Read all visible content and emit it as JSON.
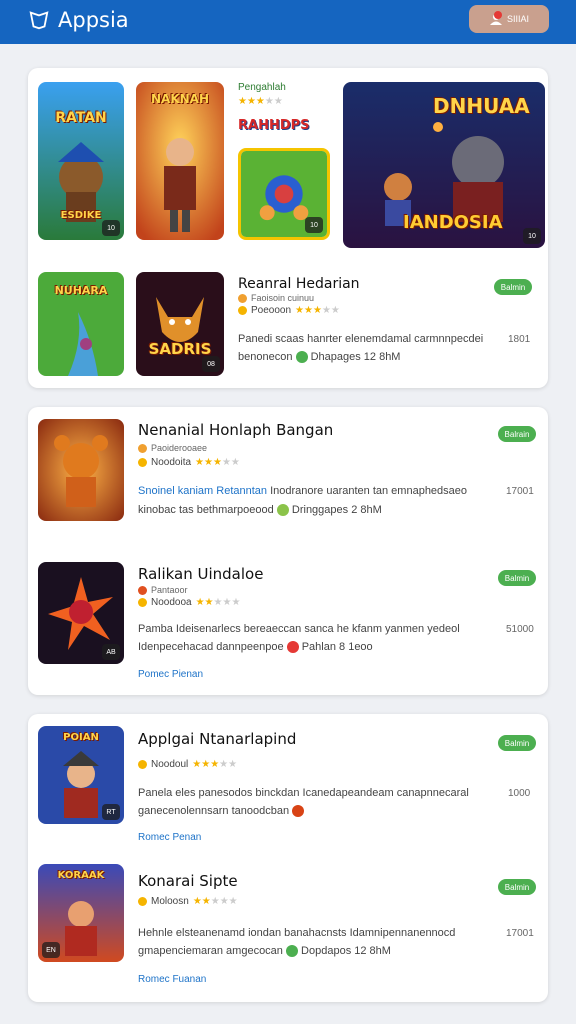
{
  "app": {
    "title": "Appsia",
    "top_button_label": "SIIIAI"
  },
  "featured": {
    "thumb1": {
      "label": "RATAN",
      "sublabel": "ESDIKE",
      "badge": "10"
    },
    "thumb2": {
      "label": "NAKNAH",
      "badge": ""
    },
    "thumb3_name": "Pengahlah",
    "thumb3_label": "RAHHDPS",
    "thumb3_badge": "10",
    "thumb4": {
      "label": "DNHUAA",
      "sublabel": "IANDOSIA",
      "badge": "10"
    },
    "thumb5": {
      "label": "NUHARA"
    },
    "thumb6": {
      "label": "SADRIS",
      "badge": "08"
    },
    "app": {
      "title": "Reanral Hedarian",
      "subtitle": "Faoisoin cuinuu",
      "rating_label": "Poeooon",
      "pill": "Balmin",
      "desc1": "Panedi scaas hanrter elenemdamal carmnnpecdei",
      "desc2": "benonecon",
      "desc2b": "Dhapages 12 8hM",
      "count": "1801"
    }
  },
  "card2": {
    "items": [
      {
        "title": "Nenanial Honlaph Bangan",
        "subtitle": "Paoiderooaee",
        "rating_label": "Noodoita",
        "pill": "Balrain",
        "desc1_accent": "Snoinel kaniam Retanntan",
        "desc1": "Inodranore uaranten tan emnaphedsaeo",
        "desc2": "kinobac tas bethmarpoeood",
        "desc2b": "Dringgapes 2 8hM",
        "count": "17001",
        "thumb_badge": "",
        "link": ""
      },
      {
        "title": "Ralikan Uindaloe",
        "subtitle": "Pantaoor",
        "rating_label": "Noodooa",
        "pill": "Balmin",
        "desc1": "Pamba Ideisenarlecs bereaeccan sanca he kfanm yanmen yedeol",
        "desc2": "Idenpecehacad dannpeenpoe",
        "desc2b": "Pahlan 8 1eoo",
        "count": "51000",
        "thumb_badge": "AB",
        "link": "Pomec Pienan"
      }
    ]
  },
  "card3": {
    "items": [
      {
        "title": "Applgai Ntanarlapind",
        "subtitle": "",
        "rating_label": "Noodoul",
        "pill": "Balmin",
        "desc1": "Panela eles panesodos binckdan Icanedapeandeam canapnnecaral",
        "desc2": "ganecenolennsarn tanoodcban",
        "desc2b": "",
        "count": "1000",
        "thumb_label": "POIAN",
        "thumb_badge": "RT",
        "link": "Romec Penan"
      },
      {
        "title": "Konarai Sipte",
        "subtitle": "",
        "rating_label": "Moloosn",
        "pill": "Balmin",
        "desc1": "Hehnle elsteanenamd iondan banahacnsts Idamnipennanennocd",
        "desc2": "gmapenciemaran amgecocan",
        "desc2b": "Dopdapos 12 8hM",
        "count": "17001",
        "thumb_label": "KORAAK",
        "thumb_badge": "EN",
        "link": "Romec Fuanan"
      }
    ]
  },
  "colors": {
    "topbar": "#1565c0",
    "pill": "#4caf50",
    "link": "#1e73c8",
    "star": "#f5b400"
  },
  "ratings": {
    "featured": 3,
    "item1": 3,
    "item2": 2,
    "item3": 3,
    "item4": 2
  }
}
